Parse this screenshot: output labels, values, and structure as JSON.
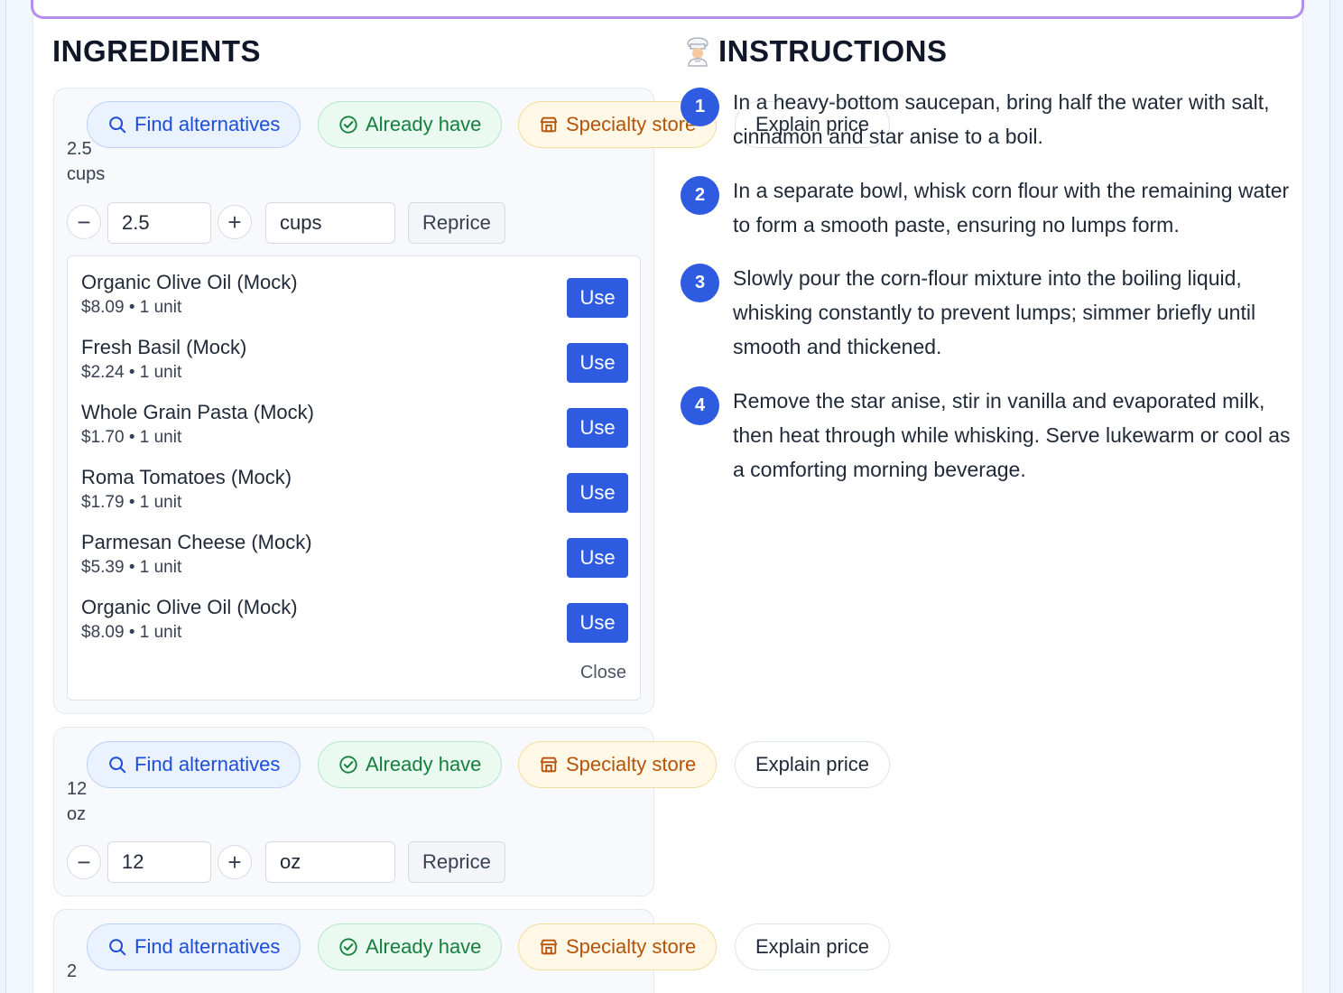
{
  "sections": {
    "ingredients_title": "INGREDIENTS",
    "instructions_title": "INSTRUCTIONS"
  },
  "chips": {
    "find": "Find alternatives",
    "have": "Already have",
    "store": "Specialty store",
    "explain": "Explain price"
  },
  "ingredients": [
    {
      "qty_line1": "2.5",
      "qty_line2": "cups",
      "amount": "2.5",
      "unit": "cups",
      "reprice": "Reprice"
    },
    {
      "qty_line1": "12",
      "qty_line2": "oz",
      "amount": "12",
      "unit": "oz",
      "reprice": "Reprice"
    },
    {
      "qty_line1": "2",
      "qty_line2": ""
    }
  ],
  "alternatives": {
    "items": [
      {
        "name": "Organic Olive Oil (Mock)",
        "meta": "$8.09 • 1 unit",
        "action": "Use"
      },
      {
        "name": "Fresh Basil (Mock)",
        "meta": "$2.24 • 1 unit",
        "action": "Use"
      },
      {
        "name": "Whole Grain Pasta (Mock)",
        "meta": "$1.70 • 1 unit",
        "action": "Use"
      },
      {
        "name": "Roma Tomatoes (Mock)",
        "meta": "$1.79 • 1 unit",
        "action": "Use"
      },
      {
        "name": "Parmesan Cheese (Mock)",
        "meta": "$5.39 • 1 unit",
        "action": "Use"
      },
      {
        "name": "Organic Olive Oil (Mock)",
        "meta": "$8.09 • 1 unit",
        "action": "Use"
      }
    ],
    "close": "Close"
  },
  "steps": [
    {
      "num": "1",
      "text": "In a heavy-bottom saucepan, bring half the water with salt, cinnamon and star anise to a boil."
    },
    {
      "num": "2",
      "text": "In a separate bowl, whisk corn flour with the remaining water to form a smooth paste, ensuring no lumps form."
    },
    {
      "num": "3",
      "text": "Slowly pour the corn-flour mixture into the boiling liquid, whisking constantly to prevent lumps; simmer briefly until smooth and thickened."
    },
    {
      "num": "4",
      "text": "Remove the star anise, stir in vanilla and evaporated milk, then heat through while whisking. Serve lukewarm or cool as a comforting morning beverage."
    }
  ],
  "icons": {
    "find": "search-icon",
    "have": "check-circle-icon",
    "store": "store-icon",
    "instructions": "chef-icon"
  },
  "colors": {
    "accent": "#2f5be0",
    "find": "#1d4ed8",
    "have": "#15803d",
    "store": "#b45309",
    "top_border": "#b58cf0"
  }
}
